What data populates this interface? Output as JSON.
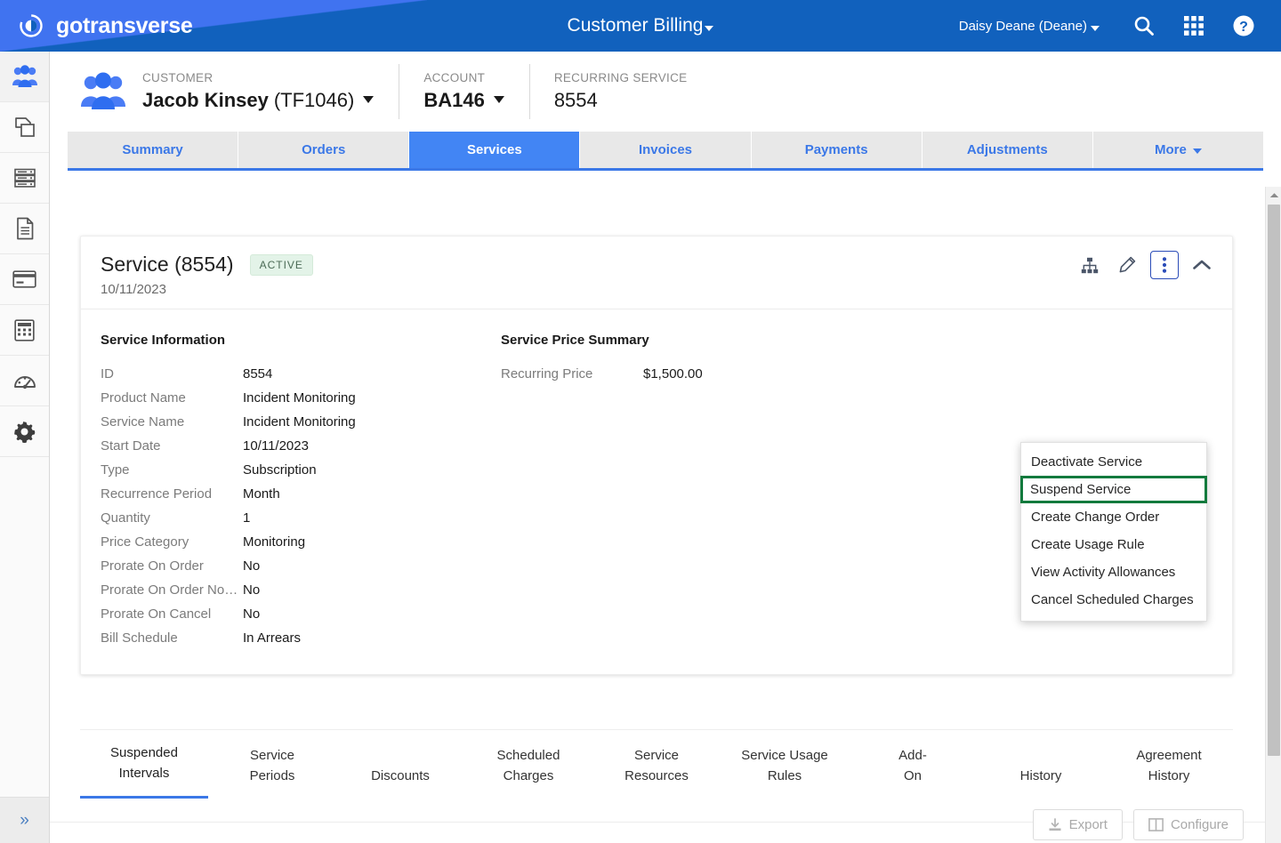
{
  "header": {
    "brand": "gotransverse",
    "brand_logo_icon": "circular-logo-icon",
    "title": "Customer Billing",
    "title_caret_icon": "caret-down-icon",
    "user": "Daisy Deane (Deane)",
    "user_caret_icon": "caret-down-icon",
    "icons": {
      "search": "search-icon",
      "apps": "apps-grid-icon",
      "help": "help-circle-icon"
    }
  },
  "sidebar": {
    "items": [
      {
        "name": "customers",
        "icon": "people-group-icon",
        "active": true
      },
      {
        "name": "products",
        "icon": "copy-documents-icon",
        "active": false
      },
      {
        "name": "servers",
        "icon": "server-stack-icon",
        "active": false
      },
      {
        "name": "documents",
        "icon": "document-icon",
        "active": false
      },
      {
        "name": "payments",
        "icon": "credit-card-icon",
        "active": false
      },
      {
        "name": "calculations",
        "icon": "calculator-icon",
        "active": false
      },
      {
        "name": "dashboard",
        "icon": "gauge-icon",
        "active": false
      },
      {
        "name": "settings",
        "icon": "gear-icon",
        "active": false
      }
    ],
    "expand_icon": "double-chevron-right-icon"
  },
  "context": {
    "avatar_icon": "people-group-icon",
    "blocks": [
      {
        "label": "CUSTOMER",
        "value_bold": "Jacob Kinsey",
        "value_light": "(TF1046)",
        "has_caret": true
      },
      {
        "label": "ACCOUNT",
        "value_bold": "BA146",
        "value_light": "",
        "has_caret": true
      },
      {
        "label": "RECURRING SERVICE",
        "value_bold": "",
        "value_light": "8554",
        "has_caret": false
      }
    ]
  },
  "tabs": [
    {
      "label": "Summary",
      "active": false,
      "caret": false
    },
    {
      "label": "Orders",
      "active": false,
      "caret": false
    },
    {
      "label": "Services",
      "active": true,
      "caret": false
    },
    {
      "label": "Invoices",
      "active": false,
      "caret": false
    },
    {
      "label": "Payments",
      "active": false,
      "caret": false
    },
    {
      "label": "Adjustments",
      "active": false,
      "caret": false
    },
    {
      "label": "More",
      "active": false,
      "caret": true
    }
  ],
  "card": {
    "title": "Service (8554)",
    "status_badge": "ACTIVE",
    "date": "10/11/2023",
    "actions": [
      {
        "name": "hierarchy-button",
        "icon": "sitemap-icon",
        "selected": false
      },
      {
        "name": "edit-button",
        "icon": "pencil-icon",
        "selected": false
      },
      {
        "name": "more-actions-button",
        "icon": "vertical-dots-icon",
        "selected": true
      },
      {
        "name": "collapse-button",
        "icon": "chevron-up-icon",
        "selected": false
      }
    ],
    "service_information": {
      "heading": "Service Information",
      "rows": [
        {
          "label": "ID",
          "value": "8554"
        },
        {
          "label": "Product Name",
          "value": "Incident Monitoring"
        },
        {
          "label": "Service Name",
          "value": "Incident Monitoring"
        },
        {
          "label": "Start Date",
          "value": "10/11/2023"
        },
        {
          "label": "Type",
          "value": "Subscription"
        },
        {
          "label": "Recurrence Period",
          "value": "Month"
        },
        {
          "label": "Quantity",
          "value": "1"
        },
        {
          "label": "Price Category",
          "value": "Monitoring"
        },
        {
          "label": "Prorate On Order",
          "value": "No"
        },
        {
          "label": "Prorate On Order No…",
          "value": "No"
        },
        {
          "label": "Prorate On Cancel",
          "value": "No"
        },
        {
          "label": "Bill Schedule",
          "value": "In Arrears"
        }
      ]
    },
    "service_price_summary": {
      "heading": "Service Price Summary",
      "rows": [
        {
          "label": "Recurring Price",
          "value": "$1,500.00"
        }
      ]
    }
  },
  "dropdown": {
    "items": [
      {
        "label": "Deactivate Service",
        "highlighted": false
      },
      {
        "label": "Suspend Service",
        "highlighted": true
      },
      {
        "label": "Create Change Order",
        "highlighted": false
      },
      {
        "label": "Create Usage Rule",
        "highlighted": false
      },
      {
        "label": "View Activity Allowances",
        "highlighted": false
      },
      {
        "label": "Cancel Scheduled Charges",
        "highlighted": false
      }
    ],
    "highlight_color": "#127a3d"
  },
  "subtabs": [
    {
      "line1": "Suspended",
      "line2": "Intervals",
      "active": true
    },
    {
      "line1": "Service",
      "line2": "Periods",
      "active": false
    },
    {
      "line1": "",
      "line2": "Discounts",
      "active": false
    },
    {
      "line1": "Scheduled",
      "line2": "Charges",
      "active": false
    },
    {
      "line1": "Service",
      "line2": "Resources",
      "active": false
    },
    {
      "line1": "Service Usage",
      "line2": "Rules",
      "active": false
    },
    {
      "line1": "Add-",
      "line2": "On",
      "active": false
    },
    {
      "line1": "",
      "line2": "History",
      "active": false
    },
    {
      "line1": "Agreement",
      "line2": "History",
      "active": false
    }
  ],
  "bottom_actions": [
    {
      "label": "Export",
      "icon": "export-download-icon"
    },
    {
      "label": "Configure",
      "icon": "columns-layout-icon"
    }
  ],
  "colors": {
    "header_dark_blue": "#1161bd",
    "header_light_blue": "#4073f0",
    "active_tab_blue": "#4285f4",
    "tab_link_blue": "#3b78e7",
    "highlight_green": "#127a3d",
    "badge_green_bg": "#e3f3e8"
  }
}
